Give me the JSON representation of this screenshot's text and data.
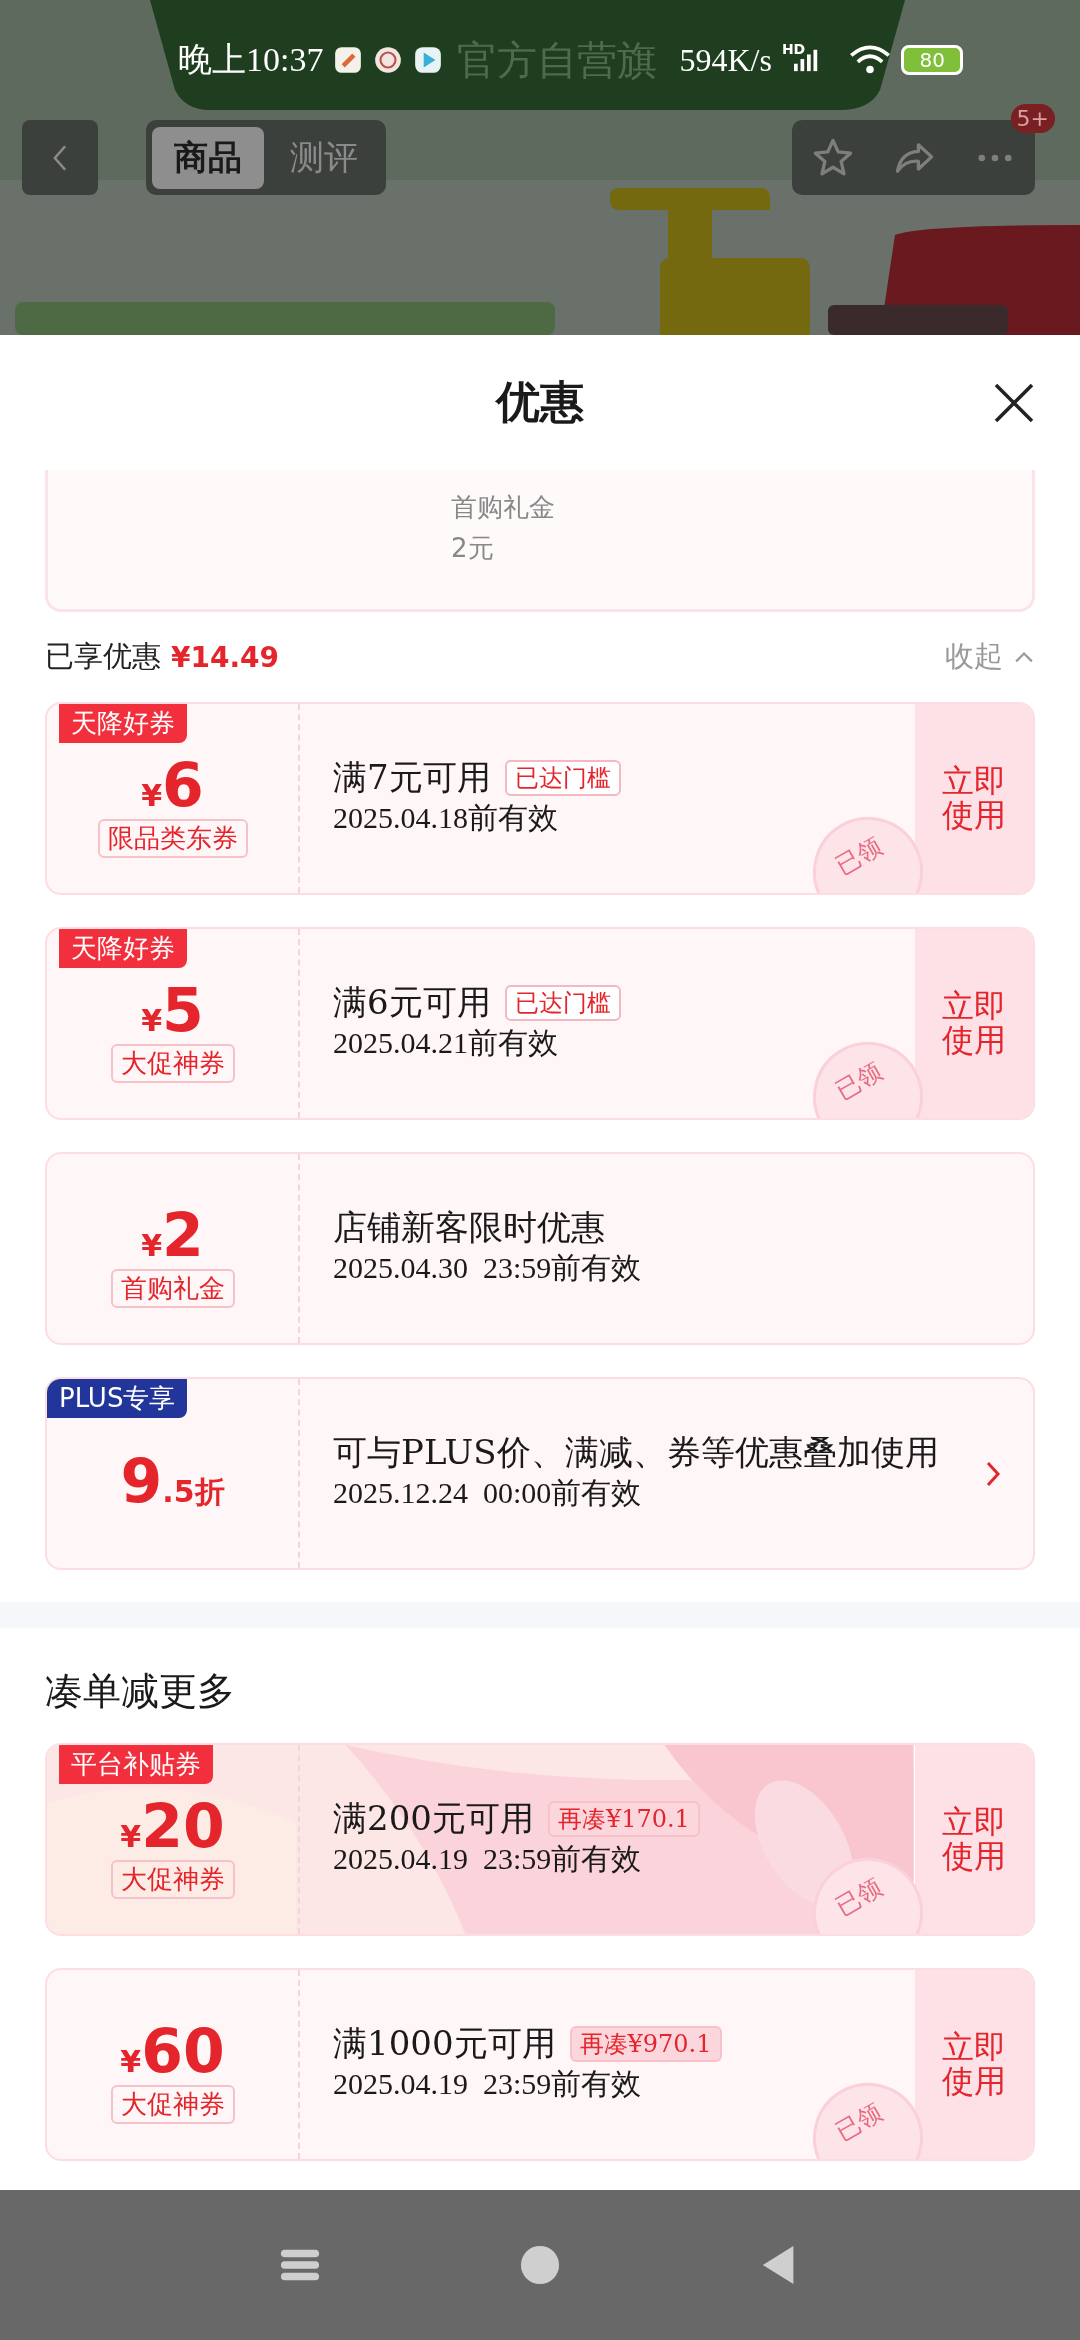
{
  "status_bar": {
    "time": "晚上10:37",
    "speed": "594K/s",
    "network": "HD",
    "battery": "80"
  },
  "background_page": {
    "store_name": "官方自营旗",
    "tabs": [
      {
        "label": "商品",
        "selected": true
      },
      {
        "label": "测评",
        "selected": false
      }
    ],
    "badge": "5+"
  },
  "sheet": {
    "title": "优惠",
    "partial_card": {
      "lines": [
        "首购礼金",
        "2元"
      ]
    },
    "summary": {
      "label": "已享优惠",
      "amount": "¥14.49",
      "collapse": "收起"
    },
    "coupons": [
      {
        "tag": {
          "text": "天降好券",
          "kind": "red"
        },
        "amount": [
          {
            "kind": "currency",
            "text": "¥"
          },
          {
            "kind": "number",
            "text": "6"
          }
        ],
        "label": "限品类东券",
        "title": "满7元可用",
        "badge": {
          "text": "已达门槛",
          "kind": "reached"
        },
        "validity": "2025.04.18前有效",
        "action": "立即使用",
        "stamp": "已领",
        "arrow": false,
        "kind": "plain"
      },
      {
        "tag": {
          "text": "天降好券",
          "kind": "red"
        },
        "amount": [
          {
            "kind": "currency",
            "text": "¥"
          },
          {
            "kind": "number",
            "text": "5"
          }
        ],
        "label": "大促神券",
        "title": "满6元可用",
        "badge": {
          "text": "已达门槛",
          "kind": "reached"
        },
        "validity": "2025.04.21前有效",
        "action": "立即使用",
        "stamp": "已领",
        "arrow": false,
        "kind": "plain"
      },
      {
        "amount": [
          {
            "kind": "currency",
            "text": "¥"
          },
          {
            "kind": "number",
            "text": "2"
          }
        ],
        "label": "首购礼金",
        "title": "店铺新客限时优惠",
        "validity": "2025.04.30  23:59前有效",
        "arrow": false,
        "kind": "plain"
      },
      {
        "tag": {
          "text": "PLUS专享",
          "kind": "plus"
        },
        "amount": [
          {
            "kind": "number",
            "text": "9"
          },
          {
            "kind": "unit",
            "text": ".5折"
          }
        ],
        "title": "可与PLUS价、满减、券等优惠叠加使用",
        "validity": "2025.12.24  00:00前有效",
        "arrow": true,
        "kind": "plain"
      }
    ],
    "more_section": {
      "title": "凑单减更多",
      "coupons": [
        {
          "tag": {
            "text": "平台补贴券",
            "kind": "red"
          },
          "amount": [
            {
              "kind": "currency",
              "text": "¥"
            },
            {
              "kind": "number",
              "text": "20"
            }
          ],
          "label": "大促神券",
          "title": "满200元可用",
          "badge": {
            "text": "再凑¥170.1",
            "kind": "more"
          },
          "validity": "2025.04.19  23:59前有效",
          "action": "立即使用",
          "stamp": "已领",
          "arrow": false,
          "kind": "promo"
        },
        {
          "amount": [
            {
              "kind": "currency",
              "text": "¥"
            },
            {
              "kind": "number",
              "text": "60"
            }
          ],
          "label": "大促神券",
          "title": "满1000元可用",
          "badge": {
            "text": "再凑¥970.1",
            "kind": "more"
          },
          "validity": "2025.04.19  23:59前有效",
          "action": "立即使用",
          "stamp": "已领",
          "arrow": false,
          "kind": "plain"
        }
      ]
    }
  }
}
